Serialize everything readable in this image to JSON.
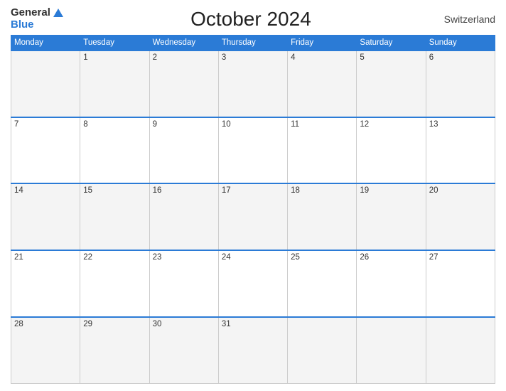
{
  "header": {
    "logo_general": "General",
    "logo_blue": "Blue",
    "title": "October 2024",
    "country": "Switzerland"
  },
  "calendar": {
    "days": [
      "Monday",
      "Tuesday",
      "Wednesday",
      "Thursday",
      "Friday",
      "Saturday",
      "Sunday"
    ],
    "weeks": [
      [
        "",
        "1",
        "2",
        "3",
        "4",
        "5",
        "6"
      ],
      [
        "7",
        "8",
        "9",
        "10",
        "11",
        "12",
        "13"
      ],
      [
        "14",
        "15",
        "16",
        "17",
        "18",
        "19",
        "20"
      ],
      [
        "21",
        "22",
        "23",
        "24",
        "25",
        "26",
        "27"
      ],
      [
        "28",
        "29",
        "30",
        "31",
        "",
        "",
        ""
      ]
    ]
  }
}
